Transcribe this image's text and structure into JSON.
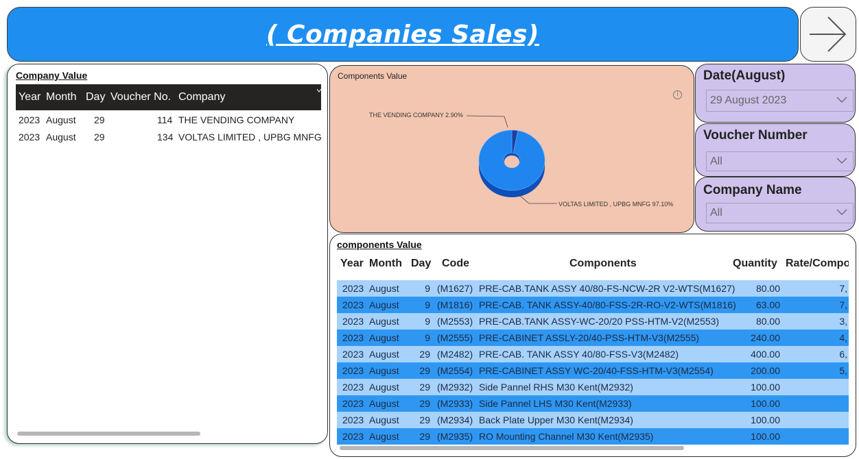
{
  "header": {
    "title": "( Companies Sales)"
  },
  "nav": {
    "icon": "arrow-right-icon"
  },
  "company_value": {
    "title": "Company Value",
    "columns": [
      "Year",
      "Month",
      "Day",
      "Voucher No.",
      "Company"
    ],
    "rows": [
      [
        "2023",
        "August",
        "29",
        "114",
        "THE VENDING COMPANY"
      ],
      [
        "2023",
        "August",
        "29",
        "134",
        "VOLTAS LIMITED , UPBG MNFG"
      ]
    ]
  },
  "components_chart": {
    "title": "Components Value",
    "info_icon": "info-icon"
  },
  "chart_data": {
    "type": "pie",
    "style": "donut-3d",
    "title": "Components Value",
    "categories": [
      "THE VENDING COMPANY",
      "VOLTAS LIMITED , UPBG MNFG"
    ],
    "values": [
      2.9,
      97.1
    ],
    "labels": [
      "THE VENDING COMPANY 2.90%",
      "VOLTAS LIMITED , UPBG MNFG 97.10%"
    ],
    "colors": [
      "#1d3f9e",
      "#2185f0"
    ]
  },
  "slicers": {
    "date": {
      "title": "Date(August)",
      "value": "29 August 2023"
    },
    "voucher": {
      "title": "Voucher Number",
      "value": "All"
    },
    "company": {
      "title": "Company Name",
      "value": "All"
    }
  },
  "components_table": {
    "title": "components Value",
    "columns": [
      "Year",
      "Month",
      "Day",
      "Code",
      "Components",
      "Quantity",
      "Rate/Compo"
    ],
    "rows": [
      [
        "2023",
        "August",
        "9",
        "(M1627)",
        "PRE-CAB.TANK ASSY 40/80-FS-NCW-2R V2-WTS(M1627)",
        "80.00",
        "7,"
      ],
      [
        "2023",
        "August",
        "9",
        "(M1816)",
        "PRE-CAB. TANK ASSY-40/80-FSS-2R-RO-V2-WTS(M1816)",
        "63.00",
        "7,"
      ],
      [
        "2023",
        "August",
        "9",
        "(M2553)",
        "PRE-CAB.TANK ASSY-WC-20/20 PSS-HTM-V2(M2553)",
        "80.00",
        "3,"
      ],
      [
        "2023",
        "August",
        "9",
        "(M2555)",
        "PRE-CABINET ASSLY-20/40-PSS-HTM-V3(M2555)",
        "240.00",
        "4,"
      ],
      [
        "2023",
        "August",
        "29",
        "(M2482)",
        "PRE-CAB. TANK ASSY 40/80-FSS-V3(M2482)",
        "400.00",
        "6,"
      ],
      [
        "2023",
        "August",
        "29",
        "(M2554)",
        "PRE-CABINET ASSY WC-20/40-FSS-HTM-V3(M2554)",
        "200.00",
        "5,"
      ],
      [
        "2023",
        "August",
        "29",
        "(M2932)",
        "Side Pannel RHS M30 Kent(M2932)",
        "100.00",
        ""
      ],
      [
        "2023",
        "August",
        "29",
        "(M2933)",
        "Side Pannel LHS M30 Kent(M2933)",
        "100.00",
        ""
      ],
      [
        "2023",
        "August",
        "29",
        "(M2934)",
        "Back Plate Upper M30 Kent(M2934)",
        "100.00",
        ""
      ],
      [
        "2023",
        "August",
        "29",
        "(M2935)",
        "RO Mounting Channel M30 Kent(M2935)",
        "100.00",
        ""
      ]
    ]
  }
}
